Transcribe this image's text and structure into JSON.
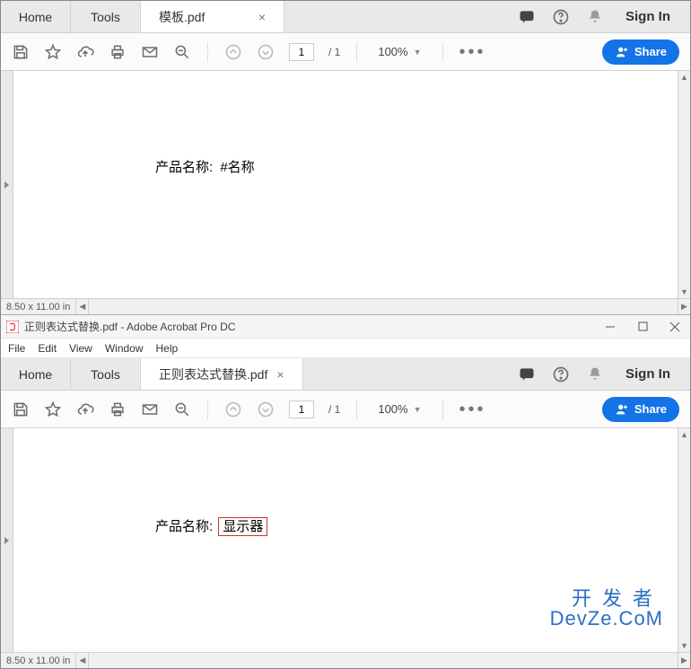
{
  "top": {
    "tabs": {
      "home": "Home",
      "tools": "Tools",
      "doc": "模板.pdf"
    },
    "signin": "Sign In",
    "toolbar": {
      "page_current": "1",
      "page_total": "/ 1",
      "zoom": "100%",
      "share": "Share"
    },
    "content": {
      "label": "产品名称:",
      "value": "#名称"
    },
    "footer": {
      "dims": "8.50 x 11.00 in"
    }
  },
  "bottom": {
    "titlebar": "正则表达式替换.pdf - Adobe Acrobat Pro DC",
    "menu": [
      "File",
      "Edit",
      "View",
      "Window",
      "Help"
    ],
    "tabs": {
      "home": "Home",
      "tools": "Tools",
      "doc": "正则表达式替换.pdf"
    },
    "signin": "Sign In",
    "toolbar": {
      "page_current": "1",
      "page_total": "/ 1",
      "zoom": "100%",
      "share": "Share"
    },
    "content": {
      "label": "产品名称:",
      "value": "显示器"
    },
    "footer": {
      "dims": "8.50 x 11.00 in"
    },
    "watermark": {
      "line1": "开发者",
      "line2": "DevZe.CoM"
    }
  },
  "icons": {
    "save": "save-icon",
    "star": "star-icon",
    "cloud": "cloud-upload-icon",
    "print": "print-icon",
    "mail": "mail-icon",
    "search": "search-minus-icon",
    "up": "page-up-icon",
    "down": "page-down-icon",
    "more": "more-icon",
    "chat": "chat-icon",
    "help": "help-icon",
    "bell": "bell-icon",
    "share_person": "person-plus-icon"
  }
}
